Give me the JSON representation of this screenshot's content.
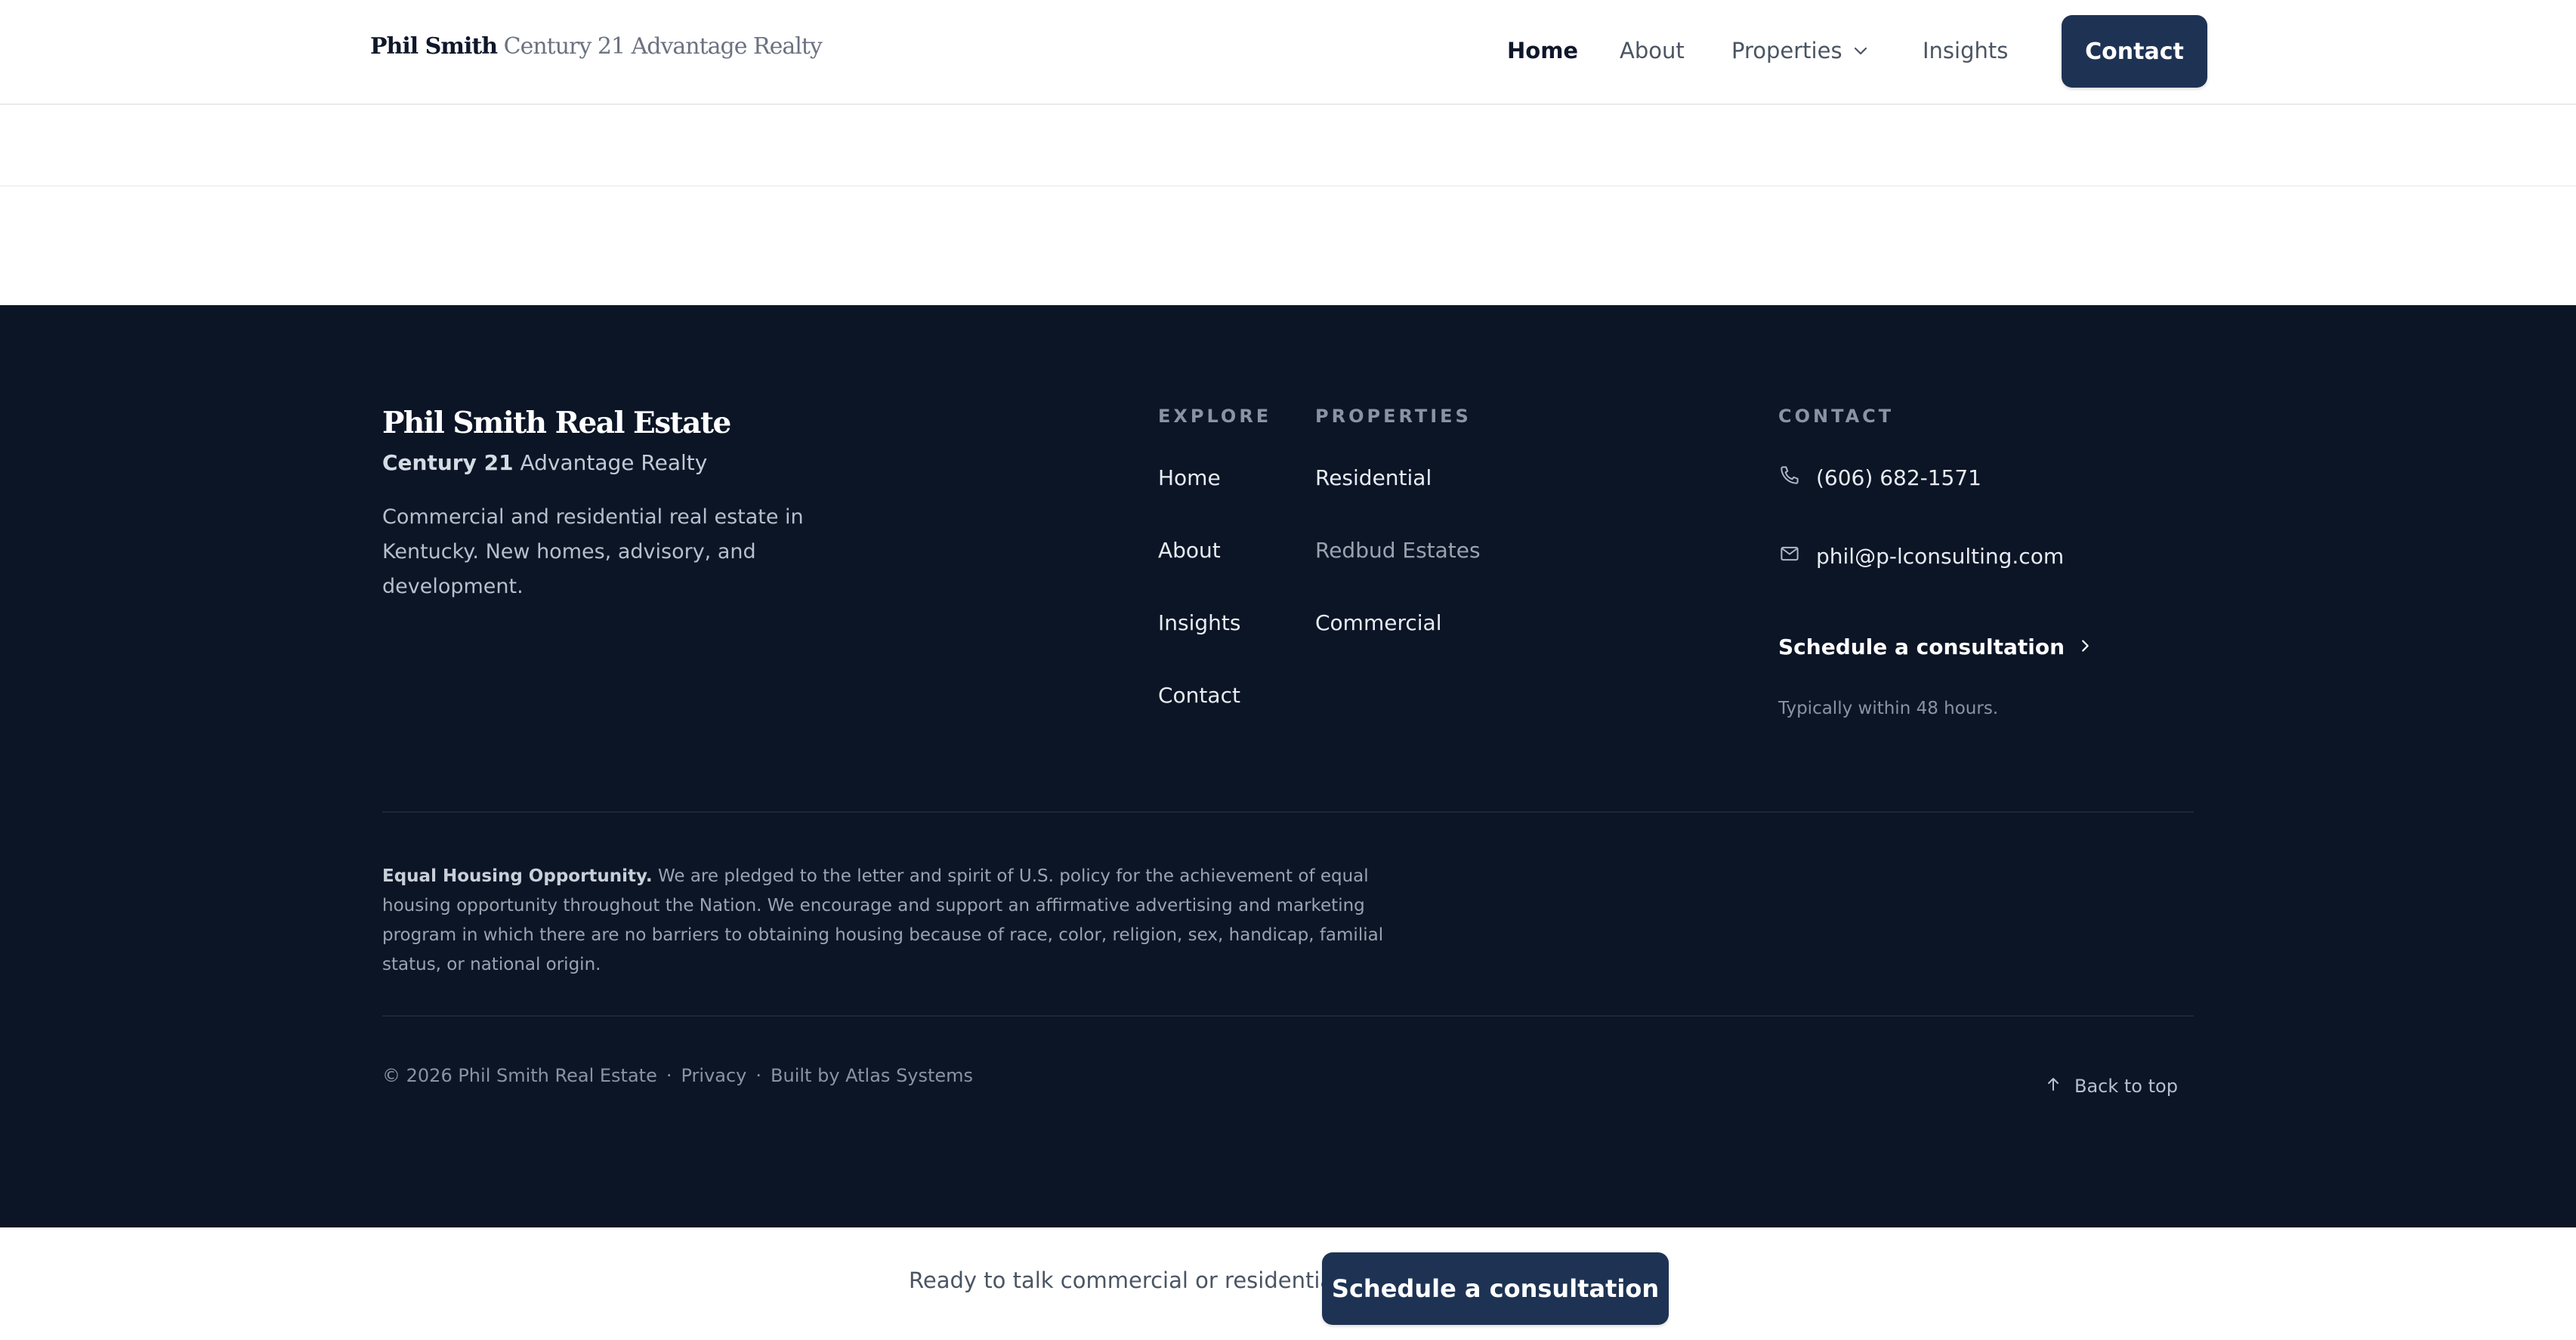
{
  "colors": {
    "navy": "#1e3354",
    "footer_bg": "#0b1526",
    "text_dark": "#0f172a",
    "text_muted": "#4b5563"
  },
  "header": {
    "brand_strong": "Phil Smith",
    "brand_muted": "Century 21 Advantage Realty",
    "nav": {
      "home": "Home",
      "about": "About",
      "properties": "Properties",
      "insights": "Insights"
    },
    "contact_button": "Contact"
  },
  "footer": {
    "title": "Phil Smith Real Estate",
    "subtitle_strong": "Century 21",
    "subtitle_rest": "Advantage Realty",
    "description": "Commercial and residential real estate in Kentucky. New homes, advisory, and development.",
    "explore": {
      "heading": "EXPLORE",
      "links": [
        "Home",
        "About",
        "Insights",
        "Contact"
      ]
    },
    "properties": {
      "heading": "PROPERTIES",
      "links": [
        "Residential",
        "Redbud Estates",
        "Commercial"
      ]
    },
    "contact": {
      "heading": "CONTACT",
      "phone": "(606) 682-1571",
      "email": "phil@p-lconsulting.com",
      "consult_link": "Schedule a consultation",
      "consult_note": "Typically within 48 hours."
    },
    "equal_housing": {
      "label": "Equal Housing Opportunity.",
      "text": "We are pledged to the letter and spirit of U.S. policy for the achievement of equal housing opportunity throughout the Nation. We encourage and support an affirmative advertising and marketing program in which there are no barriers to obtaining housing because of race, color, religion, sex, handicap, familial status, or national origin."
    },
    "legal": {
      "copyright": "© 2026 Phil Smith Real Estate",
      "separator": "·",
      "privacy": "Privacy",
      "built_by": "Built by Atlas Systems"
    },
    "back_to_top": "Back to top"
  },
  "cta_bar": {
    "text": "Ready to talk commercial or residential?",
    "button": "Schedule a consultation"
  },
  "icons": {
    "chevron_down": "chevron-down-icon",
    "phone": "phone-icon",
    "mail": "mail-icon",
    "chevron_right": "chevron-right-icon",
    "arrow_up": "arrow-up-icon"
  }
}
